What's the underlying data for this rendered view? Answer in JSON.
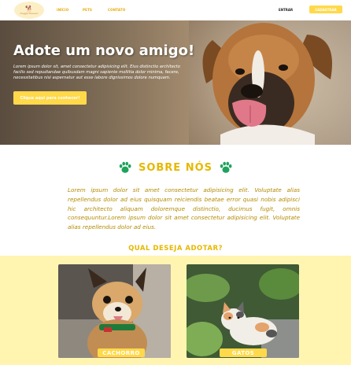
{
  "nav": {
    "logo_text": "Doggie Heaven",
    "links": [
      "INÍCIO",
      "PETS",
      "CONTATO"
    ],
    "entrar": "ENTRAR",
    "cadastrar": "CADASTRAR"
  },
  "hero": {
    "title": "Adote um novo amigo!",
    "text": "Lorem ipsum dolor sit, amet consectetur adipisicing elit. Eius distinctio architecto facilis sed repudiandae quibusdam magni sapiente mollitia dolor minima, facere, necessitatibus nisi aspernatur aut esse labore dignissimos dolore numquam.",
    "button": "Clique aqui para conhecer!"
  },
  "about": {
    "title": "SOBRE NÓS",
    "text": "Lorem ipsum dolor sit amet consectetur adipisicing elit. Voluptate alias repellendus dolor ad eius quisquam reiciendis beatae error quasi nobis adipisci hic architecto aliquam doloremque distinctio, ducimus fugit, omnis consequuntur.Lorem ipsum dolor sit amet consectetur adipisicing elit. Voluptate alias repellendus dolor ad eius.",
    "question": "QUAL DESEJA ADOTAR?"
  },
  "cards": [
    {
      "label": "CACHORRO"
    },
    {
      "label": "GATOS"
    }
  ],
  "colors": {
    "accent": "#ffd94a",
    "title": "#e6b800",
    "text": "#b38a00",
    "background_light": "#fff5b0"
  }
}
